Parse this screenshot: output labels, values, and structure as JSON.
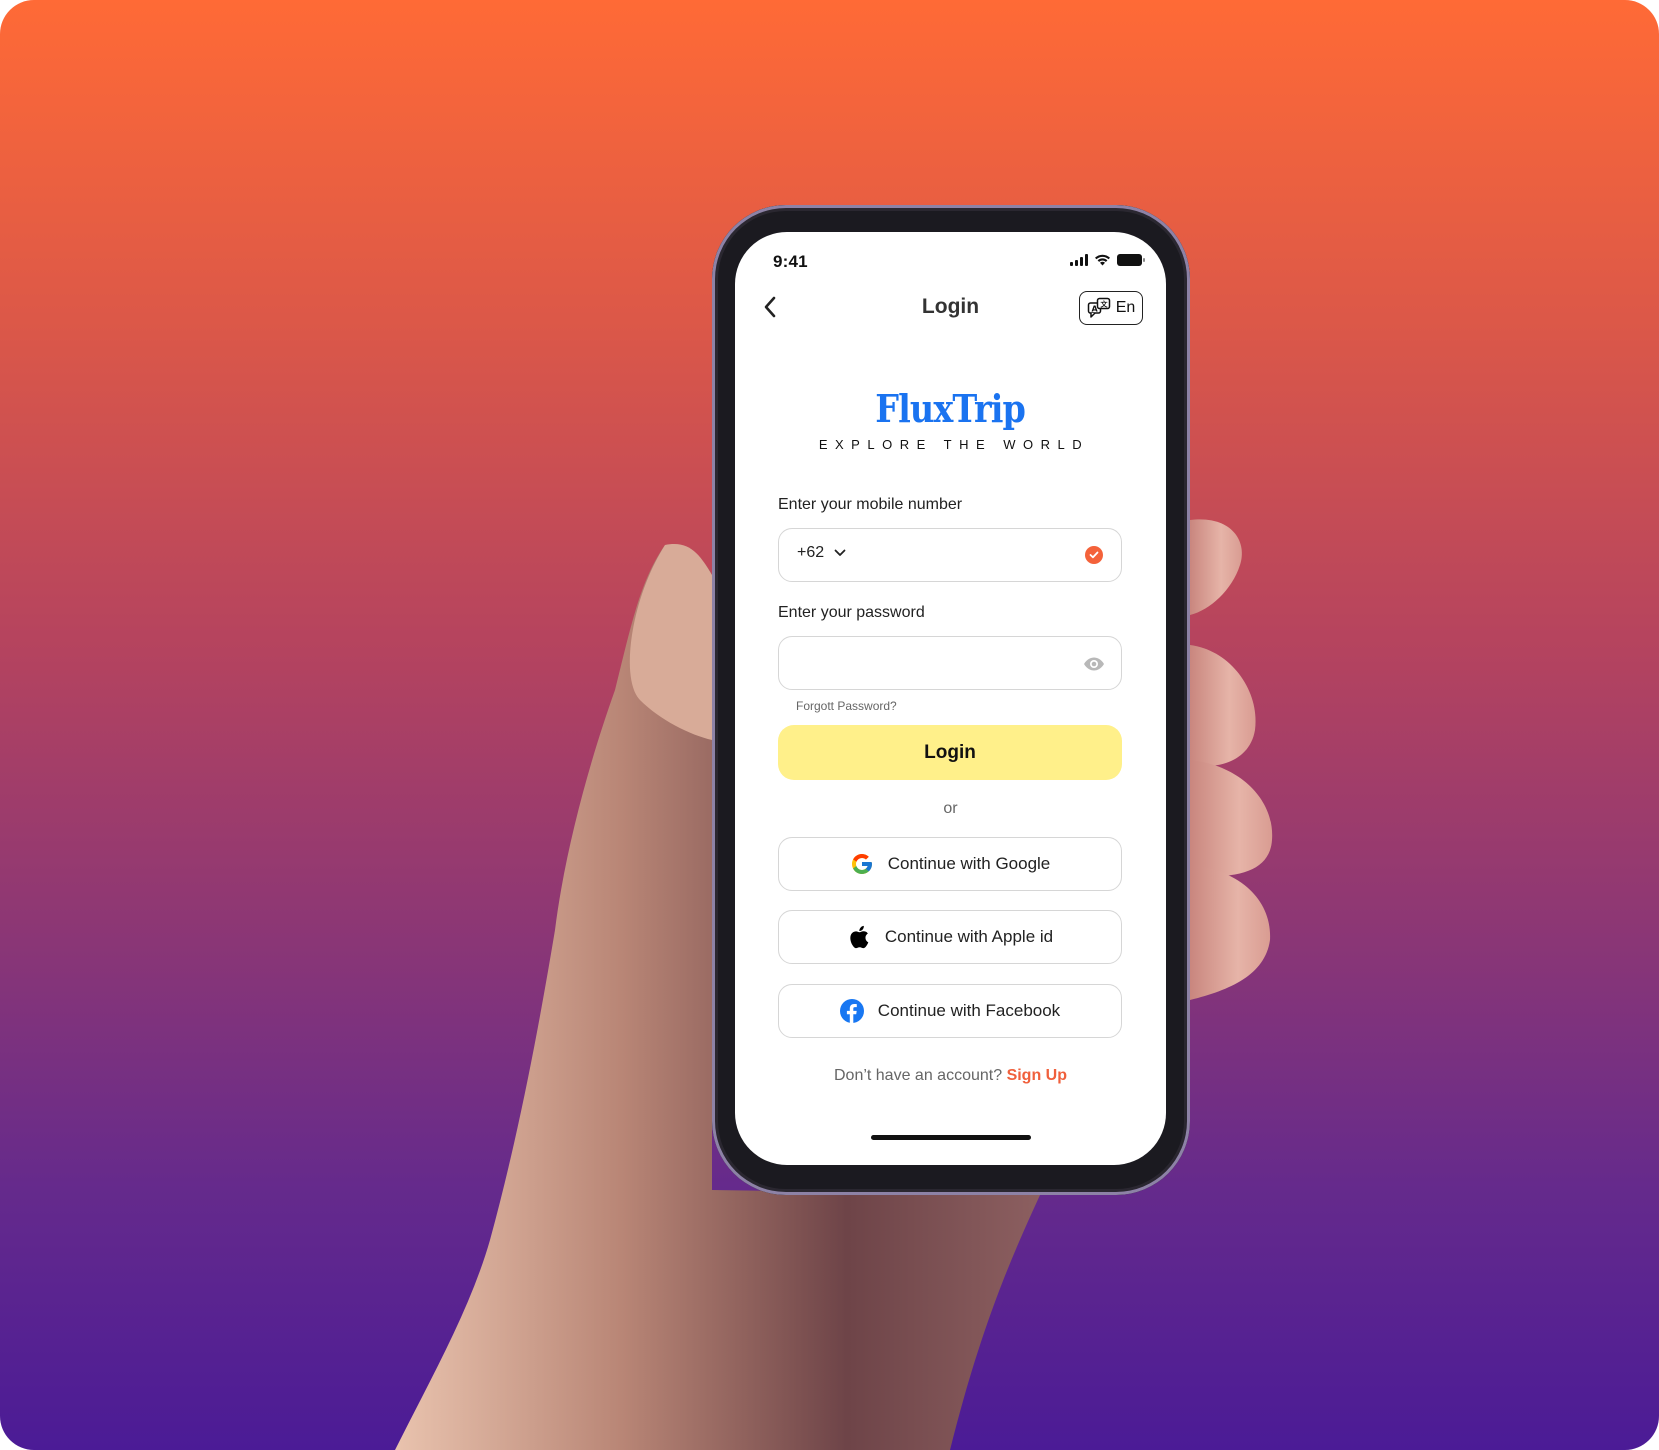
{
  "background": {
    "gradient_top": "#ff6a36",
    "gradient_bottom": "#4b1b96"
  },
  "status_bar": {
    "time": "9:41",
    "icons": [
      "cellular-signal-icon",
      "wifi-icon",
      "battery-icon"
    ]
  },
  "header": {
    "back_icon": "chevron-left-icon",
    "title": "Login",
    "language_icon": "translate-icon",
    "language_label": "En"
  },
  "logo": {
    "name": "FluxTrip",
    "tagline": "EXPLORE THE WORLD",
    "color": "#1a73f0"
  },
  "form": {
    "mobile": {
      "label": "Enter your mobile number",
      "country_code": "+62",
      "value": "",
      "status_icon": "check-circle-icon",
      "status_color": "#f4623a"
    },
    "password": {
      "label": "Enter your password",
      "value": "",
      "toggle_icon": "eye-icon"
    },
    "forgot_password": "Forgott Password?",
    "login_button": "Login",
    "login_button_color": "#fff08a",
    "divider_text": "or"
  },
  "social_login": [
    {
      "label": "Continue with Google",
      "icon": "google-icon"
    },
    {
      "label": "Continue with Apple id",
      "icon": "apple-icon"
    },
    {
      "label": "Continue with Facebook",
      "icon": "facebook-icon"
    }
  ],
  "footer": {
    "prompt": "Don’t have an account?",
    "signup_label": "Sign Up",
    "signup_color": "#f0603c"
  }
}
